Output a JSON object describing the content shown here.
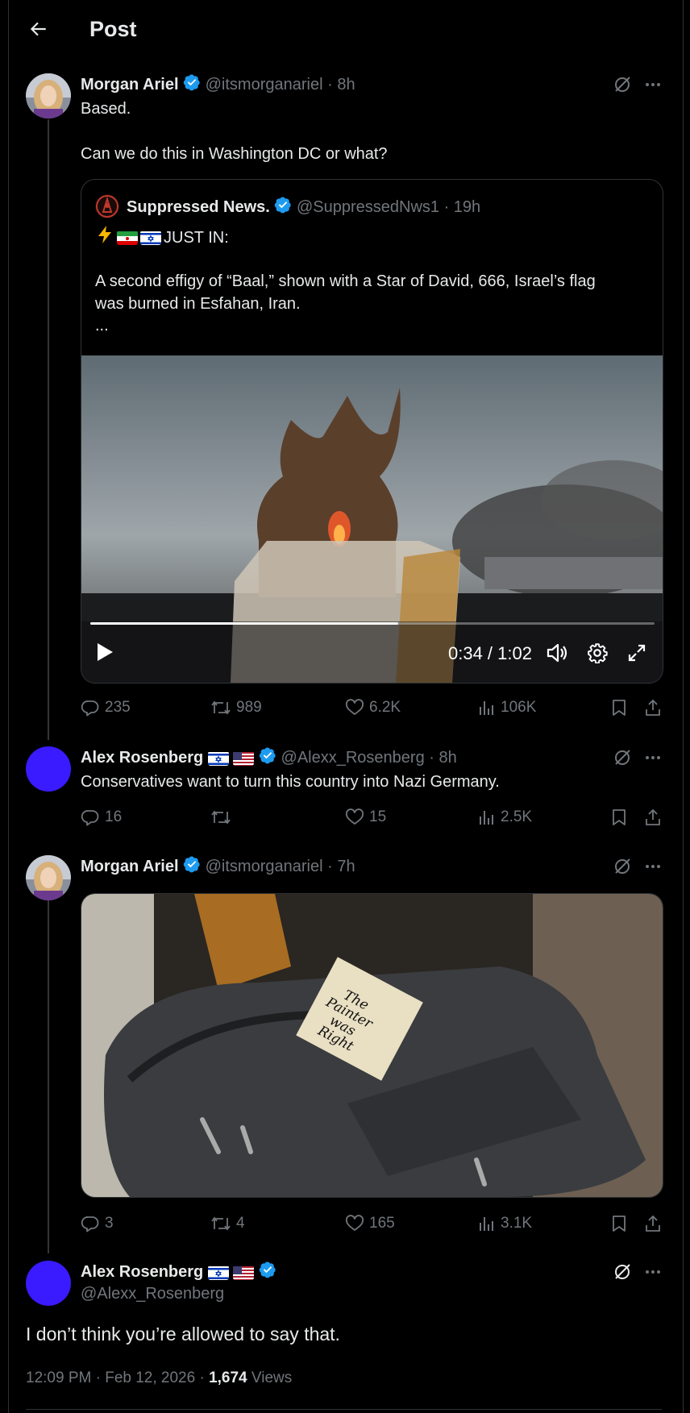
{
  "header": {
    "title": "Post",
    "back_icon": "back-arrow-icon"
  },
  "posts": [
    {
      "name": "Morgan Ariel",
      "handle": "@itsmorganariel",
      "time": "· 8h",
      "text1": "Based.",
      "text2": "Can we do this in Washington DC or what?",
      "quote": {
        "name": "Suppressed News.",
        "handle": "@SuppressedNws1",
        "time": "· 19h",
        "line1": "JUST IN:",
        "line2": "A second effigy of “Baal,” shown with a Star of David, 666, Israel’s flag",
        "line3": "was burned in Esfahan, Iran.",
        "line4": "...",
        "video": {
          "time": "0:34 / 1:02",
          "progress": 0.545
        }
      },
      "stats": {
        "replies": "235",
        "reposts": "989",
        "likes": "6.2K",
        "views": "106K"
      }
    },
    {
      "name": "Alex Rosenberg",
      "handle": "@Alexx_Rosenberg",
      "time": "· 8h",
      "text1": "Conservatives want to turn this country into Nazi Germany.",
      "stats": {
        "replies": "16",
        "reposts": "",
        "likes": "15",
        "views": "2.5K"
      }
    },
    {
      "name": "Morgan Ariel",
      "handle": "@itsmorganariel",
      "time": "· 7h",
      "image_note": [
        "The",
        "Painter",
        "was",
        "Right"
      ],
      "stats": {
        "replies": "3",
        "reposts": "4",
        "likes": "165",
        "views": "3.1K"
      }
    }
  ],
  "main": {
    "name": "Alex Rosenberg",
    "handle": "@Alexx_Rosenberg",
    "text": "I don’t think you’re allowed to say that.",
    "meta": "12:09 PM · Feb 12, 2026 ·",
    "views_count": "1,674",
    "views_label": "Views"
  },
  "colors": {
    "background": "#000000",
    "text": "#e7e9ea",
    "muted": "#71767b",
    "verified": "#1d9bf0",
    "avatar_purple": "#3a1aff"
  }
}
